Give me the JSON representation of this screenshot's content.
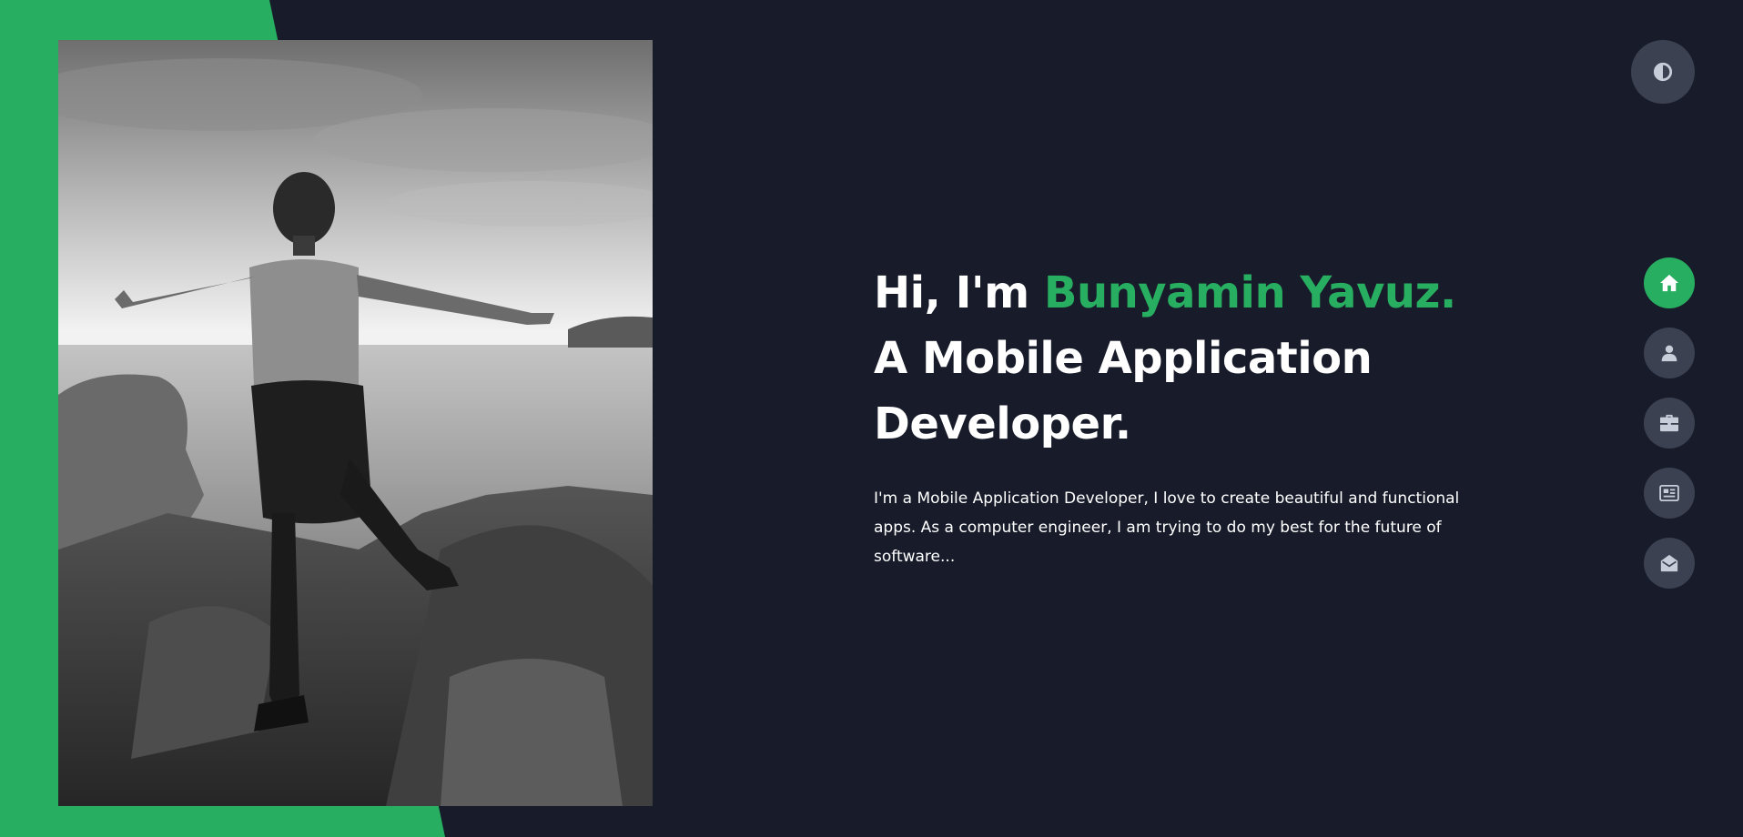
{
  "hero": {
    "greeting": "Hi, I'm ",
    "name": "Bunyamin Yavuz.",
    "role": " A Mobile Application Developer.",
    "description": "I'm a Mobile Application Developer, I love to create beautiful and functional apps. As a computer engineer, I am trying to do my best for the future of software..."
  },
  "nav": {
    "items": [
      {
        "id": "home",
        "icon": "home-icon",
        "active": true
      },
      {
        "id": "about",
        "icon": "user-icon",
        "active": false
      },
      {
        "id": "portfolio",
        "icon": "briefcase-icon",
        "active": false
      },
      {
        "id": "blog",
        "icon": "newspaper-icon",
        "active": false
      },
      {
        "id": "contact",
        "icon": "envelope-open-icon",
        "active": false
      }
    ]
  },
  "theme_toggle": {
    "icon": "contrast-icon"
  },
  "colors": {
    "background": "#181c2a",
    "accent": "#27ae60",
    "button": "#3b4150",
    "icon": "#c8ced9",
    "text": "#ffffff"
  }
}
